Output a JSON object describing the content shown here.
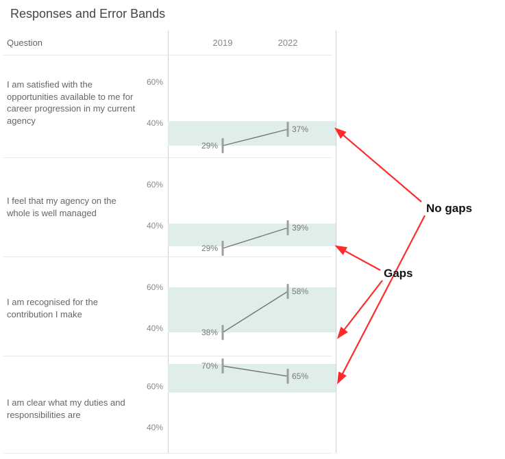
{
  "title": "Responses and Error Bands",
  "columns": {
    "question": "Question",
    "years": [
      "2019",
      "2022"
    ]
  },
  "yticks": [
    "40%",
    "60%"
  ],
  "chart_data": {
    "type": "line",
    "ylim": [
      20,
      75
    ],
    "ylabel": "",
    "xlabel": "",
    "series": [
      {
        "question": "I am satisfied with the opportunities available to me for career progression in my current agency",
        "x": [
          "2019",
          "2022"
        ],
        "values": [
          29,
          37
        ],
        "band": [
          29,
          41
        ]
      },
      {
        "question": "I feel that my agency on the whole is well managed",
        "x": [
          "2019",
          "2022"
        ],
        "values": [
          29,
          39
        ],
        "band": [
          30,
          41
        ]
      },
      {
        "question": "I am recognised for the contribution I make",
        "x": [
          "2019",
          "2022"
        ],
        "values": [
          38,
          58
        ],
        "band": [
          38,
          60
        ]
      },
      {
        "question": "I am clear what my duties and responsibilities are",
        "x": [
          "2019",
          "2022"
        ],
        "values": [
          70,
          65
        ],
        "band": [
          57,
          71
        ]
      }
    ]
  },
  "annotations": {
    "no_gaps": "No gaps",
    "gaps": "Gaps"
  }
}
